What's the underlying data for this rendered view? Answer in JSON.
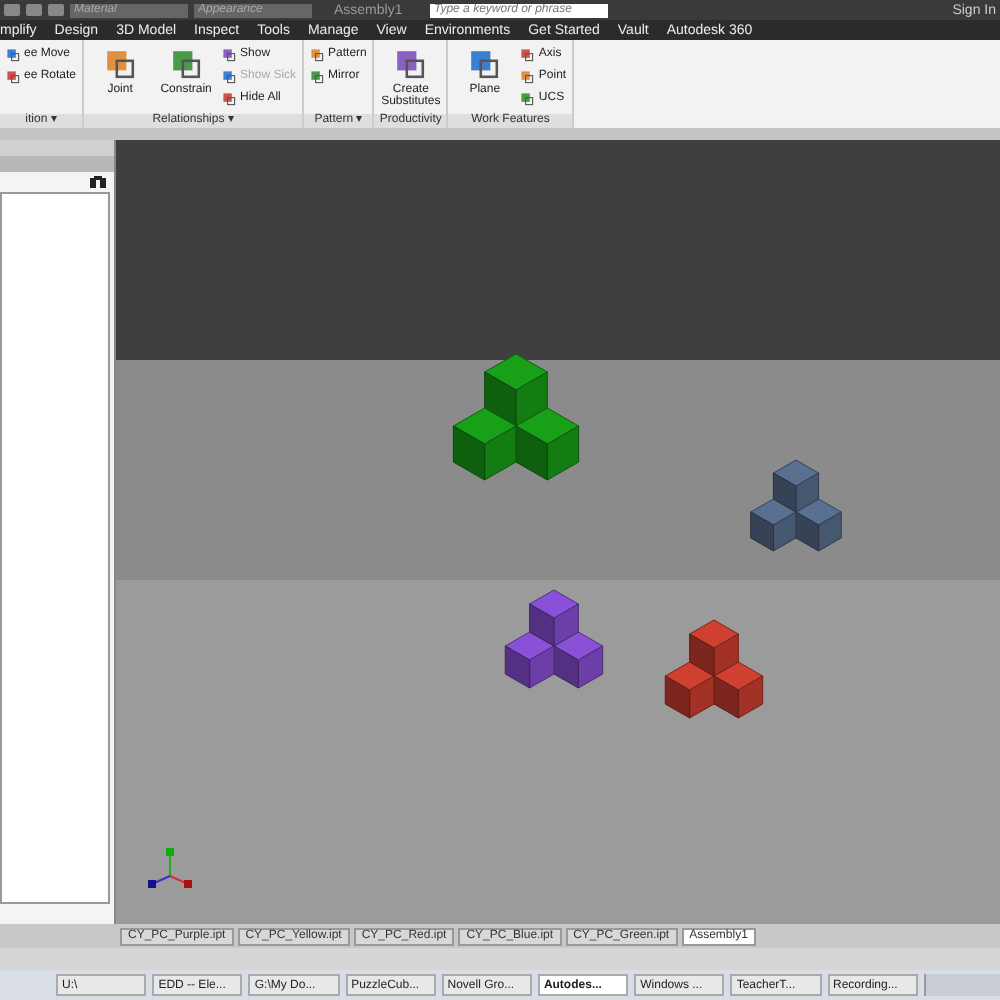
{
  "quick_access": {
    "material_placeholder": "Material",
    "appearance_placeholder": "Appearance",
    "title": "Assembly1",
    "search_placeholder": "Type a keyword or phrase",
    "sign_in": "Sign In"
  },
  "ribbon_tabs": [
    "mplify",
    "Design",
    "3D Model",
    "Inspect",
    "Tools",
    "Manage",
    "View",
    "Environments",
    "Get Started",
    "Vault",
    "Autodesk 360"
  ],
  "ribbon_groups": [
    {
      "label": "ition",
      "arrow": "▾",
      "items": [
        {
          "kind": "small",
          "label": "ee Move",
          "disabled": false
        },
        {
          "kind": "small",
          "label": "ee Rotate",
          "disabled": false
        }
      ]
    },
    {
      "label": "Relationships",
      "arrow": "▾",
      "items": [
        {
          "kind": "large",
          "label": "Joint",
          "disabled": false
        },
        {
          "kind": "large",
          "label": "Constrain",
          "disabled": false
        },
        {
          "kind": "small",
          "label": "Show",
          "disabled": false
        },
        {
          "kind": "small",
          "label": "Show Sick",
          "disabled": true
        },
        {
          "kind": "small",
          "label": "Hide All",
          "disabled": false
        }
      ]
    },
    {
      "label": "Pattern",
      "arrow": "▾",
      "items": [
        {
          "kind": "small",
          "label": "Pattern",
          "disabled": false
        },
        {
          "kind": "small",
          "label": "Mirror",
          "disabled": false
        }
      ]
    },
    {
      "label": "Productivity",
      "items": [
        {
          "kind": "large",
          "label": "Create Substitutes",
          "disabled": false
        }
      ]
    },
    {
      "label": "Work Features",
      "items": [
        {
          "kind": "large",
          "label": "Plane",
          "disabled": false
        },
        {
          "kind": "small",
          "label": "Axis",
          "disabled": false
        },
        {
          "kind": "small",
          "label": "Point",
          "disabled": false
        },
        {
          "kind": "small",
          "label": "UCS",
          "disabled": false
        }
      ]
    }
  ],
  "viewport": {
    "pieces": [
      {
        "color": "#18a018"
      },
      {
        "color": "#5a7090"
      },
      {
        "color": "#8a50d8"
      },
      {
        "color": "#d04030"
      }
    ]
  },
  "document_tabs": [
    {
      "label": "CY_PC_Purple.ipt",
      "selected": false
    },
    {
      "label": "CY_PC_Yellow.ipt",
      "selected": false
    },
    {
      "label": "CY_PC_Red.ipt",
      "selected": false
    },
    {
      "label": "CY_PC_Blue.ipt",
      "selected": false
    },
    {
      "label": "CY_PC_Green.ipt",
      "selected": false
    },
    {
      "label": "Assembly1",
      "selected": true
    }
  ],
  "taskbar": [
    {
      "label": "U:\\",
      "selected": false
    },
    {
      "label": "EDD -- Ele...",
      "selected": false
    },
    {
      "label": "G:\\My Do...",
      "selected": false
    },
    {
      "label": "PuzzleCub...",
      "selected": false
    },
    {
      "label": "Novell Gro...",
      "selected": false
    },
    {
      "label": "Autodes...",
      "selected": true
    },
    {
      "label": "Windows ...",
      "selected": false
    },
    {
      "label": "TeacherT...",
      "selected": false
    },
    {
      "label": "Recording...",
      "selected": false
    }
  ]
}
